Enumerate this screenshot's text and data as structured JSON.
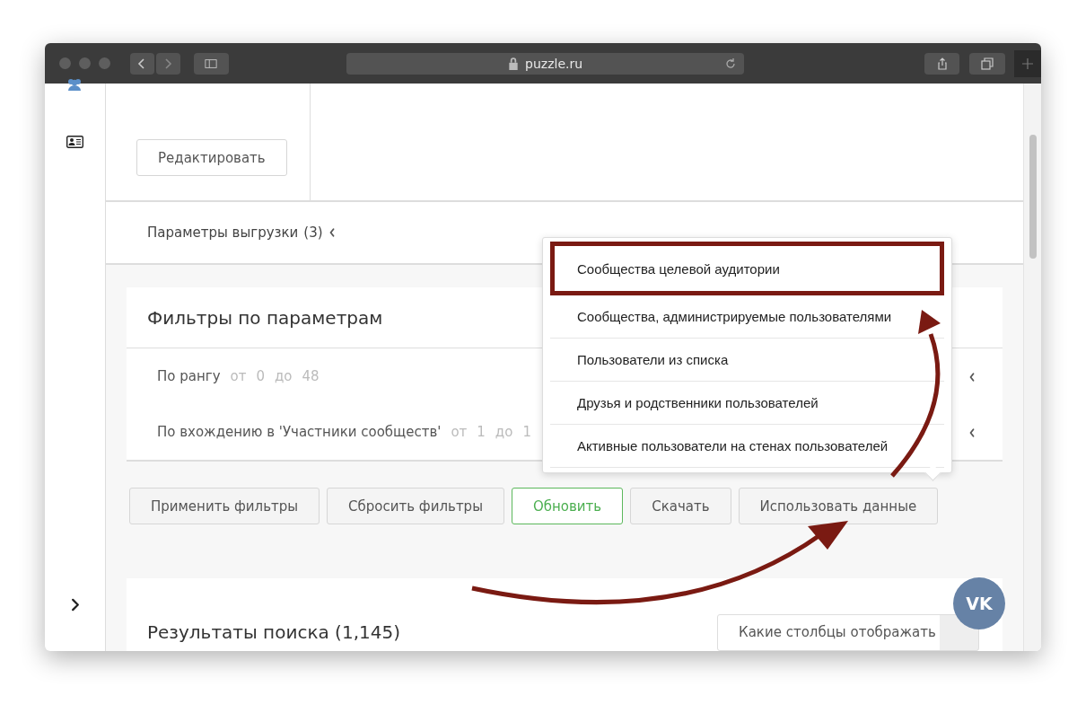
{
  "browser": {
    "address": "puzzle.ru"
  },
  "edit_button": "Редактировать",
  "export_params": {
    "label": "Параметры выгрузки",
    "count": "(3)"
  },
  "filters": {
    "title": "Фильтры по параметрам",
    "rows": [
      {
        "label": "По рангу",
        "from_label": "от",
        "from": "0",
        "to_label": "до",
        "to": "48"
      },
      {
        "label": "По вхождению в 'Участники сообществ'",
        "from_label": "от",
        "from": "1",
        "to_label": "до",
        "to": "1"
      }
    ]
  },
  "buttons": [
    {
      "label": "Применить фильтры",
      "kind": "default"
    },
    {
      "label": "Сбросить фильтры",
      "kind": "default"
    },
    {
      "label": "Обновить",
      "kind": "success"
    },
    {
      "label": "Скачать",
      "kind": "default"
    },
    {
      "label": "Использовать данные",
      "kind": "default"
    }
  ],
  "dropdown": {
    "items": [
      {
        "label": "Сообщества целевой аудитории",
        "highlighted": true
      },
      {
        "label": "Сообщества, администрируемые пользователями",
        "highlighted": false
      },
      {
        "label": "Пользователи из списка",
        "highlighted": false
      },
      {
        "label": "Друзья и родственники пользователей",
        "highlighted": false
      },
      {
        "label": "Активные пользователи на стенах пользователей",
        "highlighted": false
      }
    ]
  },
  "results": {
    "title": "Результаты поиска (1,145)",
    "columns_button": "Какие столбцы отображать"
  },
  "vk_badge": "VK"
}
